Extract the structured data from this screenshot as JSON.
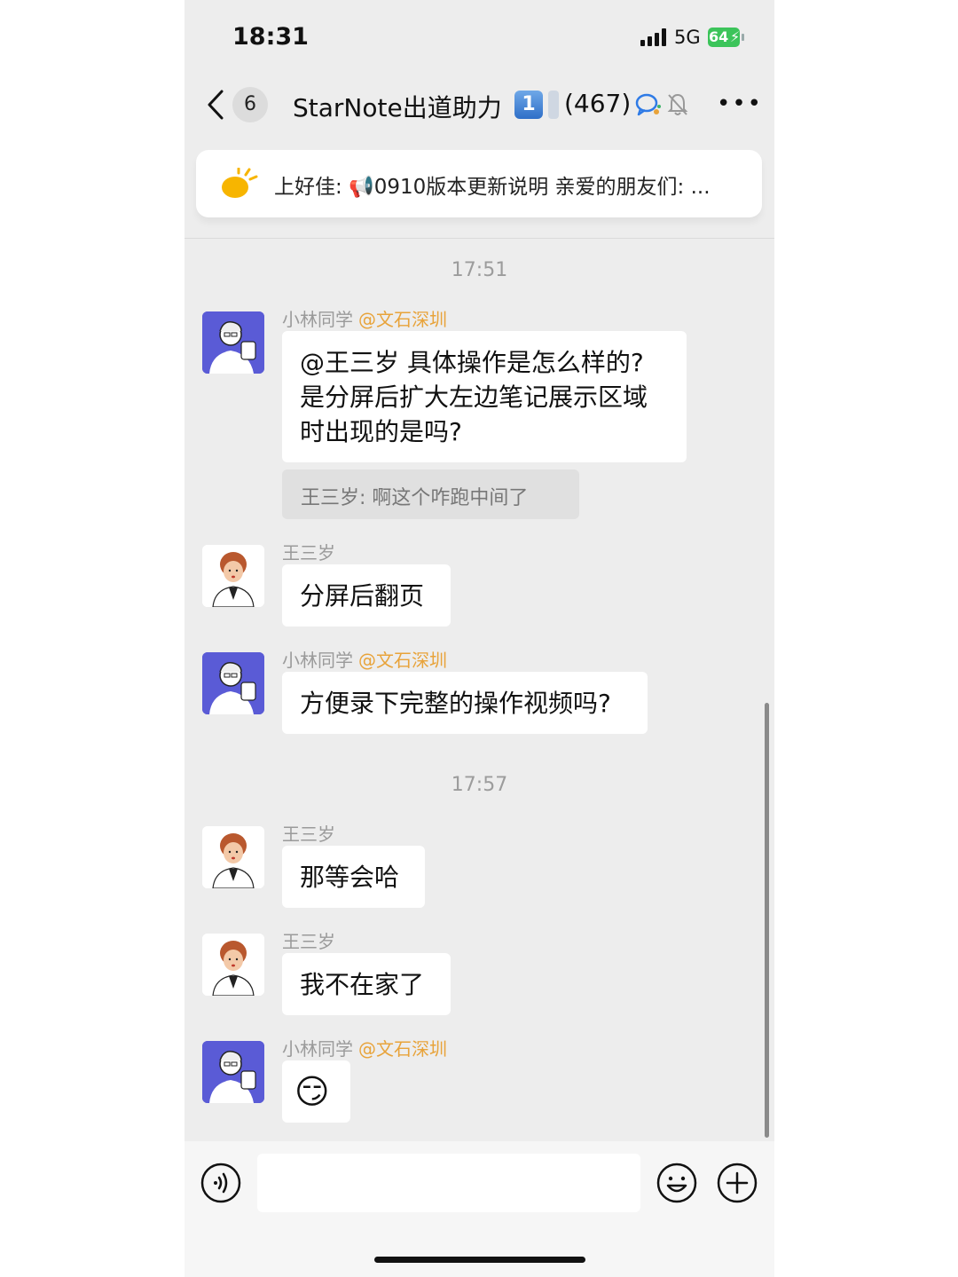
{
  "status_bar": {
    "time": "18:31",
    "network": "5G",
    "battery": "64"
  },
  "nav": {
    "unread_count": "6",
    "group_name": "StarNote出道助力",
    "badge": "1",
    "member_count": "(467)"
  },
  "notice": {
    "text": "上好佳: 📢0910版本更新说明  亲爱的朋友们: ..."
  },
  "messages": {
    "ts1": "17:51",
    "m1": {
      "sender": "小林同学",
      "tag": "@文石深圳",
      "lines": [
        "@王三岁 具体操作是怎么样的?",
        "是分屏后扩大左边笔记展示区域",
        "时出现的是吗?"
      ],
      "quote": "王三岁:  啊这个咋跑中间了"
    },
    "m2": {
      "sender": "王三岁",
      "text": "分屏后翻页"
    },
    "m3": {
      "sender": "小林同学",
      "tag": "@文石深圳",
      "text": "方便录下完整的操作视频吗?"
    },
    "ts2": "17:57",
    "m4": {
      "sender": "王三岁",
      "text": "那等会哈"
    },
    "m5": {
      "sender": "王三岁",
      "text": "我不在家了"
    },
    "m6": {
      "sender": "小林同学",
      "tag": "@文石深圳",
      "emoji": "😏"
    }
  },
  "colors": {
    "background": "#ededed",
    "bubble": "#ffffff",
    "tag": "#e8a33a",
    "quote_bg": "#e0e0e0",
    "battery": "#3cc45a"
  },
  "icons": [
    "signal-icon",
    "battery-icon",
    "back-icon",
    "group-chat-icon",
    "mute-bell-icon",
    "more-icon",
    "sun-icon",
    "voice-icon",
    "emoji-icon",
    "plus-icon"
  ]
}
